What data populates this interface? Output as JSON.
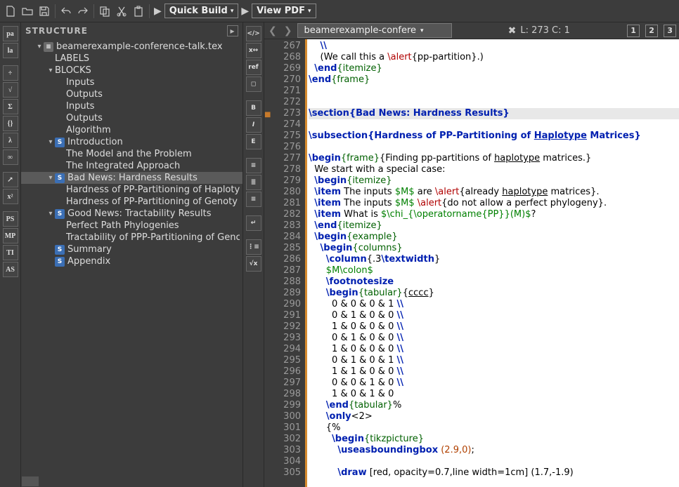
{
  "toolbar": {
    "quick_build": "Quick Build",
    "view_pdf": "View PDF"
  },
  "panel_title": "STRUCTURE",
  "file_tab": "beamerexample-confere",
  "cursor_pos": "L: 273 C: 1",
  "bookmarks": [
    "1",
    "2",
    "3"
  ],
  "tree": {
    "file": "beamerexample-conference-talk.tex",
    "labels": "LABELS",
    "blocks": "BLOCKS",
    "block_items": [
      "Inputs",
      "Outputs",
      "Inputs",
      "Outputs",
      "Algorithm"
    ],
    "sections": [
      {
        "t": "Introduction",
        "kids": [
          "The Model and the Problem",
          "The Integrated Approach"
        ]
      },
      {
        "t": "Bad News: Hardness Results",
        "sel": true,
        "kids": [
          "Hardness of PP-Partitioning of Haploty",
          "Hardness of PP-Partitioning of Genoty"
        ]
      },
      {
        "t": "Good News: Tractability Results",
        "kids": [
          "Perfect Path Phylogenies",
          "Tractability of PPP-Partitioning of Genc"
        ]
      },
      {
        "t": "Summary"
      },
      {
        "t": "Appendix"
      }
    ]
  },
  "code": {
    "first_line": 267,
    "lines": [
      {
        "n": 267,
        "seg": [
          {
            "t": "    "
          },
          {
            "c": "cmd",
            "t": "\\\\"
          }
        ]
      },
      {
        "n": 268,
        "seg": [
          {
            "t": "    (We call this a "
          },
          {
            "c": "al",
            "t": "\\alert"
          },
          {
            "t": "{pp-partition}.)"
          }
        ]
      },
      {
        "n": 269,
        "seg": [
          {
            "t": "  "
          },
          {
            "c": "cmd",
            "t": "\\end"
          },
          {
            "c": "kw",
            "t": "{itemize}"
          }
        ]
      },
      {
        "n": 270,
        "seg": [
          {
            "c": "cmd",
            "t": "\\end"
          },
          {
            "c": "kw",
            "t": "{frame}"
          }
        ]
      },
      {
        "n": 271,
        "seg": [
          {
            "t": ""
          }
        ]
      },
      {
        "n": 272,
        "seg": [
          {
            "t": ""
          }
        ]
      },
      {
        "n": 273,
        "mark": true,
        "hl": true,
        "seg": [
          {
            "c": "sec",
            "t": "\\section{Bad News: Hardness Results}"
          }
        ]
      },
      {
        "n": 274,
        "seg": [
          {
            "t": ""
          }
        ]
      },
      {
        "n": 275,
        "seg": [
          {
            "c": "sec",
            "t": "\\subsection{Hardness of PP-Partitioning of "
          },
          {
            "c": "sec ul",
            "t": "Haplotype"
          },
          {
            "c": "sec",
            "t": " Matrices}"
          }
        ]
      },
      {
        "n": 276,
        "seg": [
          {
            "t": ""
          }
        ]
      },
      {
        "n": 277,
        "seg": [
          {
            "c": "cmd",
            "t": "\\begin"
          },
          {
            "c": "kw",
            "t": "{frame}"
          },
          {
            "t": "{Finding pp-partitions of "
          },
          {
            "c": "ul",
            "t": "haplotype"
          },
          {
            "t": " matrices.}"
          }
        ]
      },
      {
        "n": 278,
        "seg": [
          {
            "t": "  We start with a special case:"
          }
        ]
      },
      {
        "n": 279,
        "seg": [
          {
            "t": "  "
          },
          {
            "c": "cmd",
            "t": "\\begin"
          },
          {
            "c": "kw",
            "t": "{itemize}"
          }
        ]
      },
      {
        "n": 280,
        "seg": [
          {
            "t": "  "
          },
          {
            "c": "cmd",
            "t": "\\item"
          },
          {
            "t": " The inputs "
          },
          {
            "c": "mth",
            "t": "$M$"
          },
          {
            "t": " are "
          },
          {
            "c": "al",
            "t": "\\alert"
          },
          {
            "t": "{already "
          },
          {
            "c": "ul",
            "t": "haplotype"
          },
          {
            "t": " matrices}."
          }
        ]
      },
      {
        "n": 281,
        "seg": [
          {
            "t": "  "
          },
          {
            "c": "cmd",
            "t": "\\item"
          },
          {
            "t": " The inputs "
          },
          {
            "c": "mth",
            "t": "$M$"
          },
          {
            "t": " "
          },
          {
            "c": "al",
            "t": "\\alert"
          },
          {
            "t": "{do not allow a perfect phylogeny}."
          }
        ]
      },
      {
        "n": 282,
        "seg": [
          {
            "t": "  "
          },
          {
            "c": "cmd",
            "t": "\\item"
          },
          {
            "t": " What is "
          },
          {
            "c": "mth",
            "t": "$\\chi_{\\operatorname{PP}}(M)$"
          },
          {
            "t": "?"
          }
        ]
      },
      {
        "n": 283,
        "seg": [
          {
            "t": "  "
          },
          {
            "c": "cmd",
            "t": "\\end"
          },
          {
            "c": "kw",
            "t": "{itemize}"
          }
        ]
      },
      {
        "n": 284,
        "seg": [
          {
            "t": "  "
          },
          {
            "c": "cmd",
            "t": "\\begin"
          },
          {
            "c": "kw",
            "t": "{example}"
          }
        ]
      },
      {
        "n": 285,
        "seg": [
          {
            "t": "    "
          },
          {
            "c": "cmd",
            "t": "\\begin"
          },
          {
            "c": "kw",
            "t": "{columns}"
          }
        ]
      },
      {
        "n": 286,
        "seg": [
          {
            "t": "      "
          },
          {
            "c": "cmd",
            "t": "\\column"
          },
          {
            "t": "{.3"
          },
          {
            "c": "cmd",
            "t": "\\textwidth"
          },
          {
            "t": "}"
          }
        ]
      },
      {
        "n": 287,
        "seg": [
          {
            "t": "      "
          },
          {
            "c": "mth",
            "t": "$M\\colon$"
          }
        ]
      },
      {
        "n": 288,
        "seg": [
          {
            "t": "      "
          },
          {
            "c": "cmd",
            "t": "\\footnotesize"
          }
        ]
      },
      {
        "n": 289,
        "seg": [
          {
            "t": "      "
          },
          {
            "c": "cmd",
            "t": "\\begin"
          },
          {
            "c": "kw",
            "t": "{tabular}"
          },
          {
            "t": "{"
          },
          {
            "c": "ul",
            "t": "cccc"
          },
          {
            "t": "}"
          }
        ]
      },
      {
        "n": 290,
        "seg": [
          {
            "t": "        0 & 0 & 0 & 1 "
          },
          {
            "c": "cmd",
            "t": "\\\\"
          }
        ]
      },
      {
        "n": 291,
        "seg": [
          {
            "t": "        0 & 1 & 0 & 0 "
          },
          {
            "c": "cmd",
            "t": "\\\\"
          }
        ]
      },
      {
        "n": 292,
        "seg": [
          {
            "t": "        1 & 0 & 0 & 0 "
          },
          {
            "c": "cmd",
            "t": "\\\\"
          }
        ]
      },
      {
        "n": 293,
        "seg": [
          {
            "t": "        0 & 1 & 0 & 0 "
          },
          {
            "c": "cmd",
            "t": "\\\\"
          }
        ]
      },
      {
        "n": 294,
        "seg": [
          {
            "t": "        1 & 0 & 0 & 0 "
          },
          {
            "c": "cmd",
            "t": "\\\\"
          }
        ]
      },
      {
        "n": 295,
        "seg": [
          {
            "t": "        0 & 1 & 0 & 1 "
          },
          {
            "c": "cmd",
            "t": "\\\\"
          }
        ]
      },
      {
        "n": 296,
        "seg": [
          {
            "t": "        1 & 1 & 0 & 0 "
          },
          {
            "c": "cmd",
            "t": "\\\\"
          }
        ]
      },
      {
        "n": 297,
        "seg": [
          {
            "t": "        0 & 0 & 1 & 0 "
          },
          {
            "c": "cmd",
            "t": "\\\\"
          }
        ]
      },
      {
        "n": 298,
        "seg": [
          {
            "t": "        1 & 0 & 1 & 0"
          }
        ]
      },
      {
        "n": 299,
        "seg": [
          {
            "t": "      "
          },
          {
            "c": "cmd",
            "t": "\\end"
          },
          {
            "c": "kw",
            "t": "{tabular}"
          },
          {
            "t": "%"
          }
        ]
      },
      {
        "n": 300,
        "seg": [
          {
            "t": "      "
          },
          {
            "c": "cmd",
            "t": "\\only"
          },
          {
            "t": "<2>"
          }
        ]
      },
      {
        "n": 301,
        "seg": [
          {
            "t": "      {%"
          }
        ]
      },
      {
        "n": 302,
        "seg": [
          {
            "t": "        "
          },
          {
            "c": "cmd",
            "t": "\\begin"
          },
          {
            "c": "kw",
            "t": "{tikzpicture}"
          }
        ]
      },
      {
        "n": 303,
        "seg": [
          {
            "t": "          "
          },
          {
            "c": "cmd",
            "t": "\\useasboundingbox"
          },
          {
            "t": " "
          },
          {
            "c": "num",
            "t": "(2.9,0)"
          },
          {
            "t": ";"
          }
        ]
      },
      {
        "n": 304,
        "seg": [
          {
            "t": ""
          }
        ]
      },
      {
        "n": 305,
        "seg": [
          {
            "t": "          "
          },
          {
            "c": "cmd",
            "t": "\\draw"
          },
          {
            "t": " [red, opacity=0.7,line width=1cm] (1.7,-1.9)"
          }
        ]
      }
    ]
  }
}
